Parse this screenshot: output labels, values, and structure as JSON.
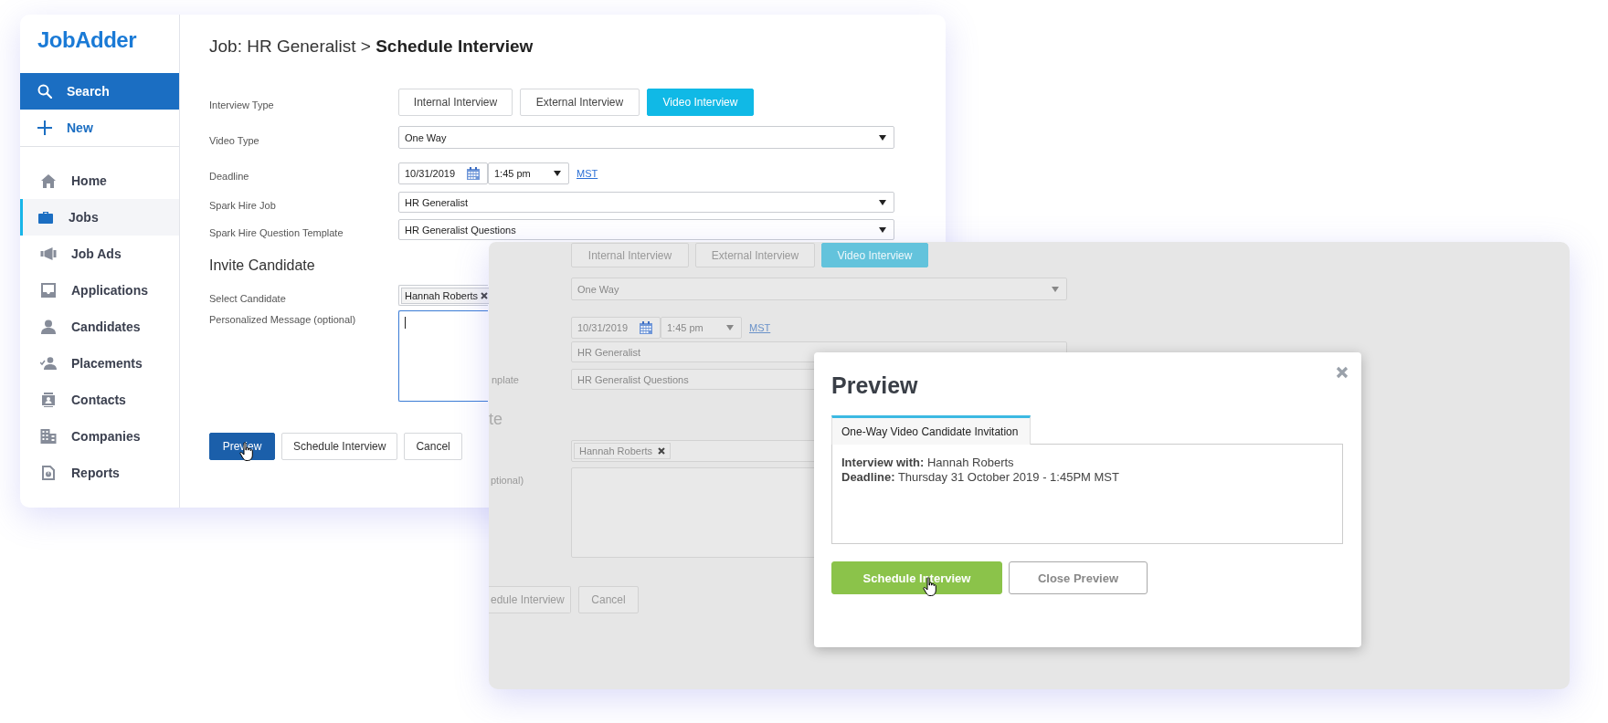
{
  "main_window": {
    "logo": "JobAdder",
    "sidebar": {
      "actions": [
        {
          "label": "Search",
          "selected": true
        },
        {
          "label": "New",
          "selected": false
        }
      ],
      "items": [
        {
          "label": "Home",
          "selected": false
        },
        {
          "label": "Jobs",
          "selected": true
        },
        {
          "label": "Job Ads",
          "selected": false
        },
        {
          "label": "Applications",
          "selected": false
        },
        {
          "label": "Candidates",
          "selected": false
        },
        {
          "label": "Placements",
          "selected": false
        },
        {
          "label": "Contacts",
          "selected": false
        },
        {
          "label": "Companies",
          "selected": false
        },
        {
          "label": "Reports",
          "selected": false
        }
      ]
    },
    "title": {
      "path": "Job: HR Generalist >",
      "current": "Schedule Interview"
    },
    "form": {
      "interview_type": {
        "label": "Interview Type",
        "options": [
          {
            "label": "Internal Interview",
            "selected": false
          },
          {
            "label": "External Interview",
            "selected": false
          },
          {
            "label": "Video Interview",
            "selected": true
          }
        ]
      },
      "video_type": {
        "label": "Video Type",
        "value": "One Way"
      },
      "deadline": {
        "label": "Deadline",
        "date": "10/31/2019",
        "time": "1:45 pm",
        "timezone": "MST"
      },
      "spark_hire_job": {
        "label": "Spark Hire Job",
        "value": "HR Generalist"
      },
      "question_template": {
        "label": "Spark Hire Question Template",
        "value": "HR Generalist Questions"
      }
    },
    "invite": {
      "heading": "Invite Candidate",
      "candidate_label": "Select Candidate",
      "candidate": "Hannah Roberts",
      "message_label": "Personalized Message (optional)"
    },
    "buttons": [
      {
        "label": "Preview",
        "kind": "primary"
      },
      {
        "label": "Schedule Interview",
        "kind": "default"
      },
      {
        "label": "Cancel",
        "kind": "default"
      }
    ]
  },
  "background_window": {
    "interview_options": [
      {
        "label": "Internal Interview",
        "selected": false
      },
      {
        "label": "External Interview",
        "selected": false
      },
      {
        "label": "Video Interview",
        "selected": true
      }
    ],
    "video_type": "One Way",
    "date": "10/31/2019",
    "time": "1:45 pm",
    "timezone": "MST",
    "spark_hire_job": "HR Generalist",
    "template_label": "nplate",
    "question_template": "HR Generalist Questions",
    "heading": "te",
    "candidate": "Hannah Roberts",
    "message_label": "ptional)",
    "buttons": [
      "edule Interview",
      "Cancel"
    ]
  },
  "preview_dialog": {
    "title": "Preview",
    "tab": {
      "label": "One-Way Video Candidate Invitation",
      "selected": true
    },
    "lines": [
      "**Interview with:** Hannah Roberts",
      "**Deadline:** Thursday 31 October 2019 - 1:45PM MST"
    ],
    "buttons": [
      {
        "label": "Schedule Interview",
        "kind": "primary"
      },
      {
        "label": "Close Preview",
        "kind": "secondary"
      }
    ]
  }
}
